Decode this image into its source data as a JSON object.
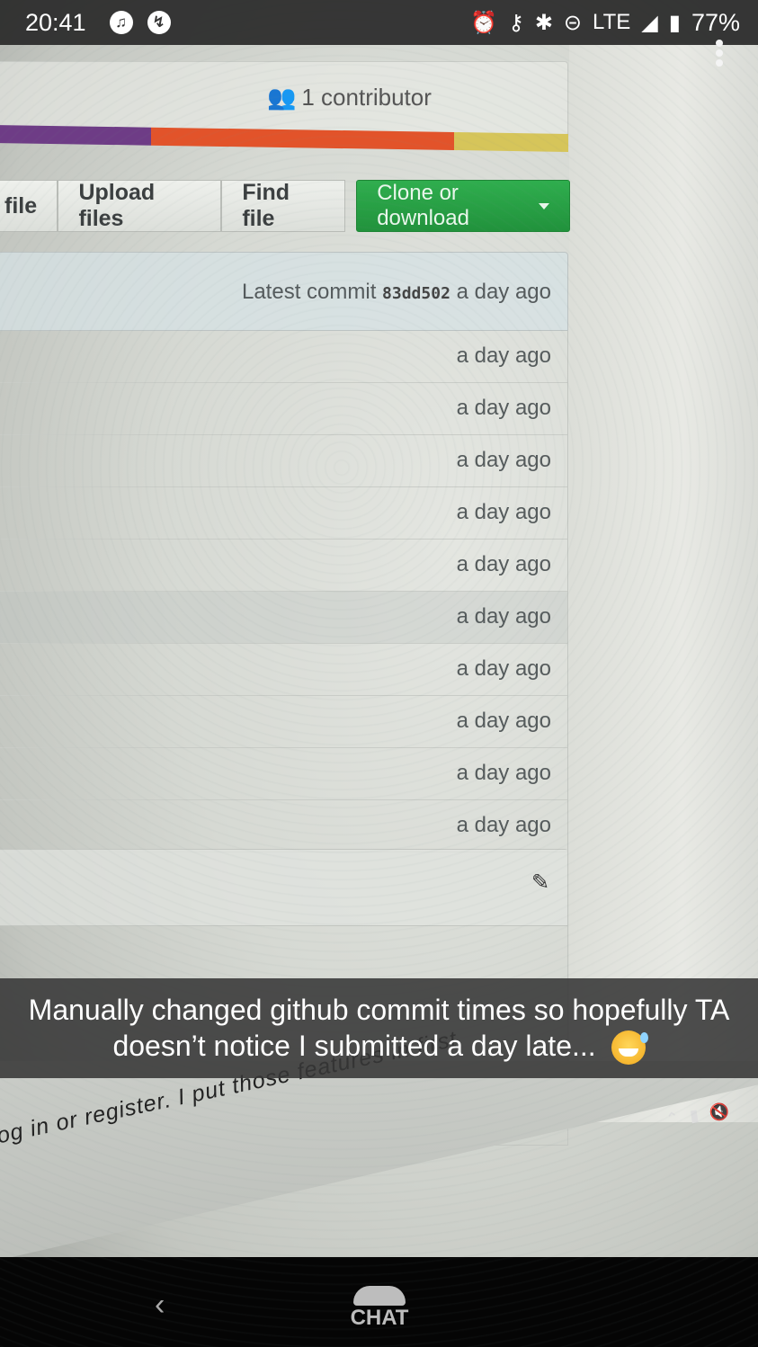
{
  "status_bar": {
    "time": "20:41",
    "network": "LTE",
    "battery": "77%"
  },
  "github": {
    "contributors": "1 contributor",
    "language_bar": [
      {
        "color": "#6e3c86",
        "fraction": 0.27
      },
      {
        "color": "#e2532a",
        "fraction": 0.53
      },
      {
        "color": "#d6c55a",
        "fraction": 0.2
      }
    ],
    "buttons": {
      "create_file": "file",
      "upload_files": "Upload files",
      "find_file": "Find file",
      "clone_or_download": "Clone or download"
    },
    "latest_commit": {
      "label": "Latest commit",
      "sha": "83dd502",
      "age": "a day ago"
    },
    "file_rows": [
      {
        "age": "a day ago"
      },
      {
        "age": "a day ago"
      },
      {
        "age": "a day ago"
      },
      {
        "age": "a day ago"
      },
      {
        "age": "a day ago"
      },
      {
        "age": "a day ago"
      },
      {
        "age": "a day ago"
      },
      {
        "age": "a day ago"
      },
      {
        "age": "a day ago"
      },
      {
        "age": "a day ago"
      }
    ],
    "readme_line": "og in or register. I put those features in first"
  },
  "caption": {
    "text": "Manually changed github commit times so hopefully TA doesn’t notice I submitted a day late..."
  },
  "nav": {
    "chat_label": "CHAT"
  }
}
